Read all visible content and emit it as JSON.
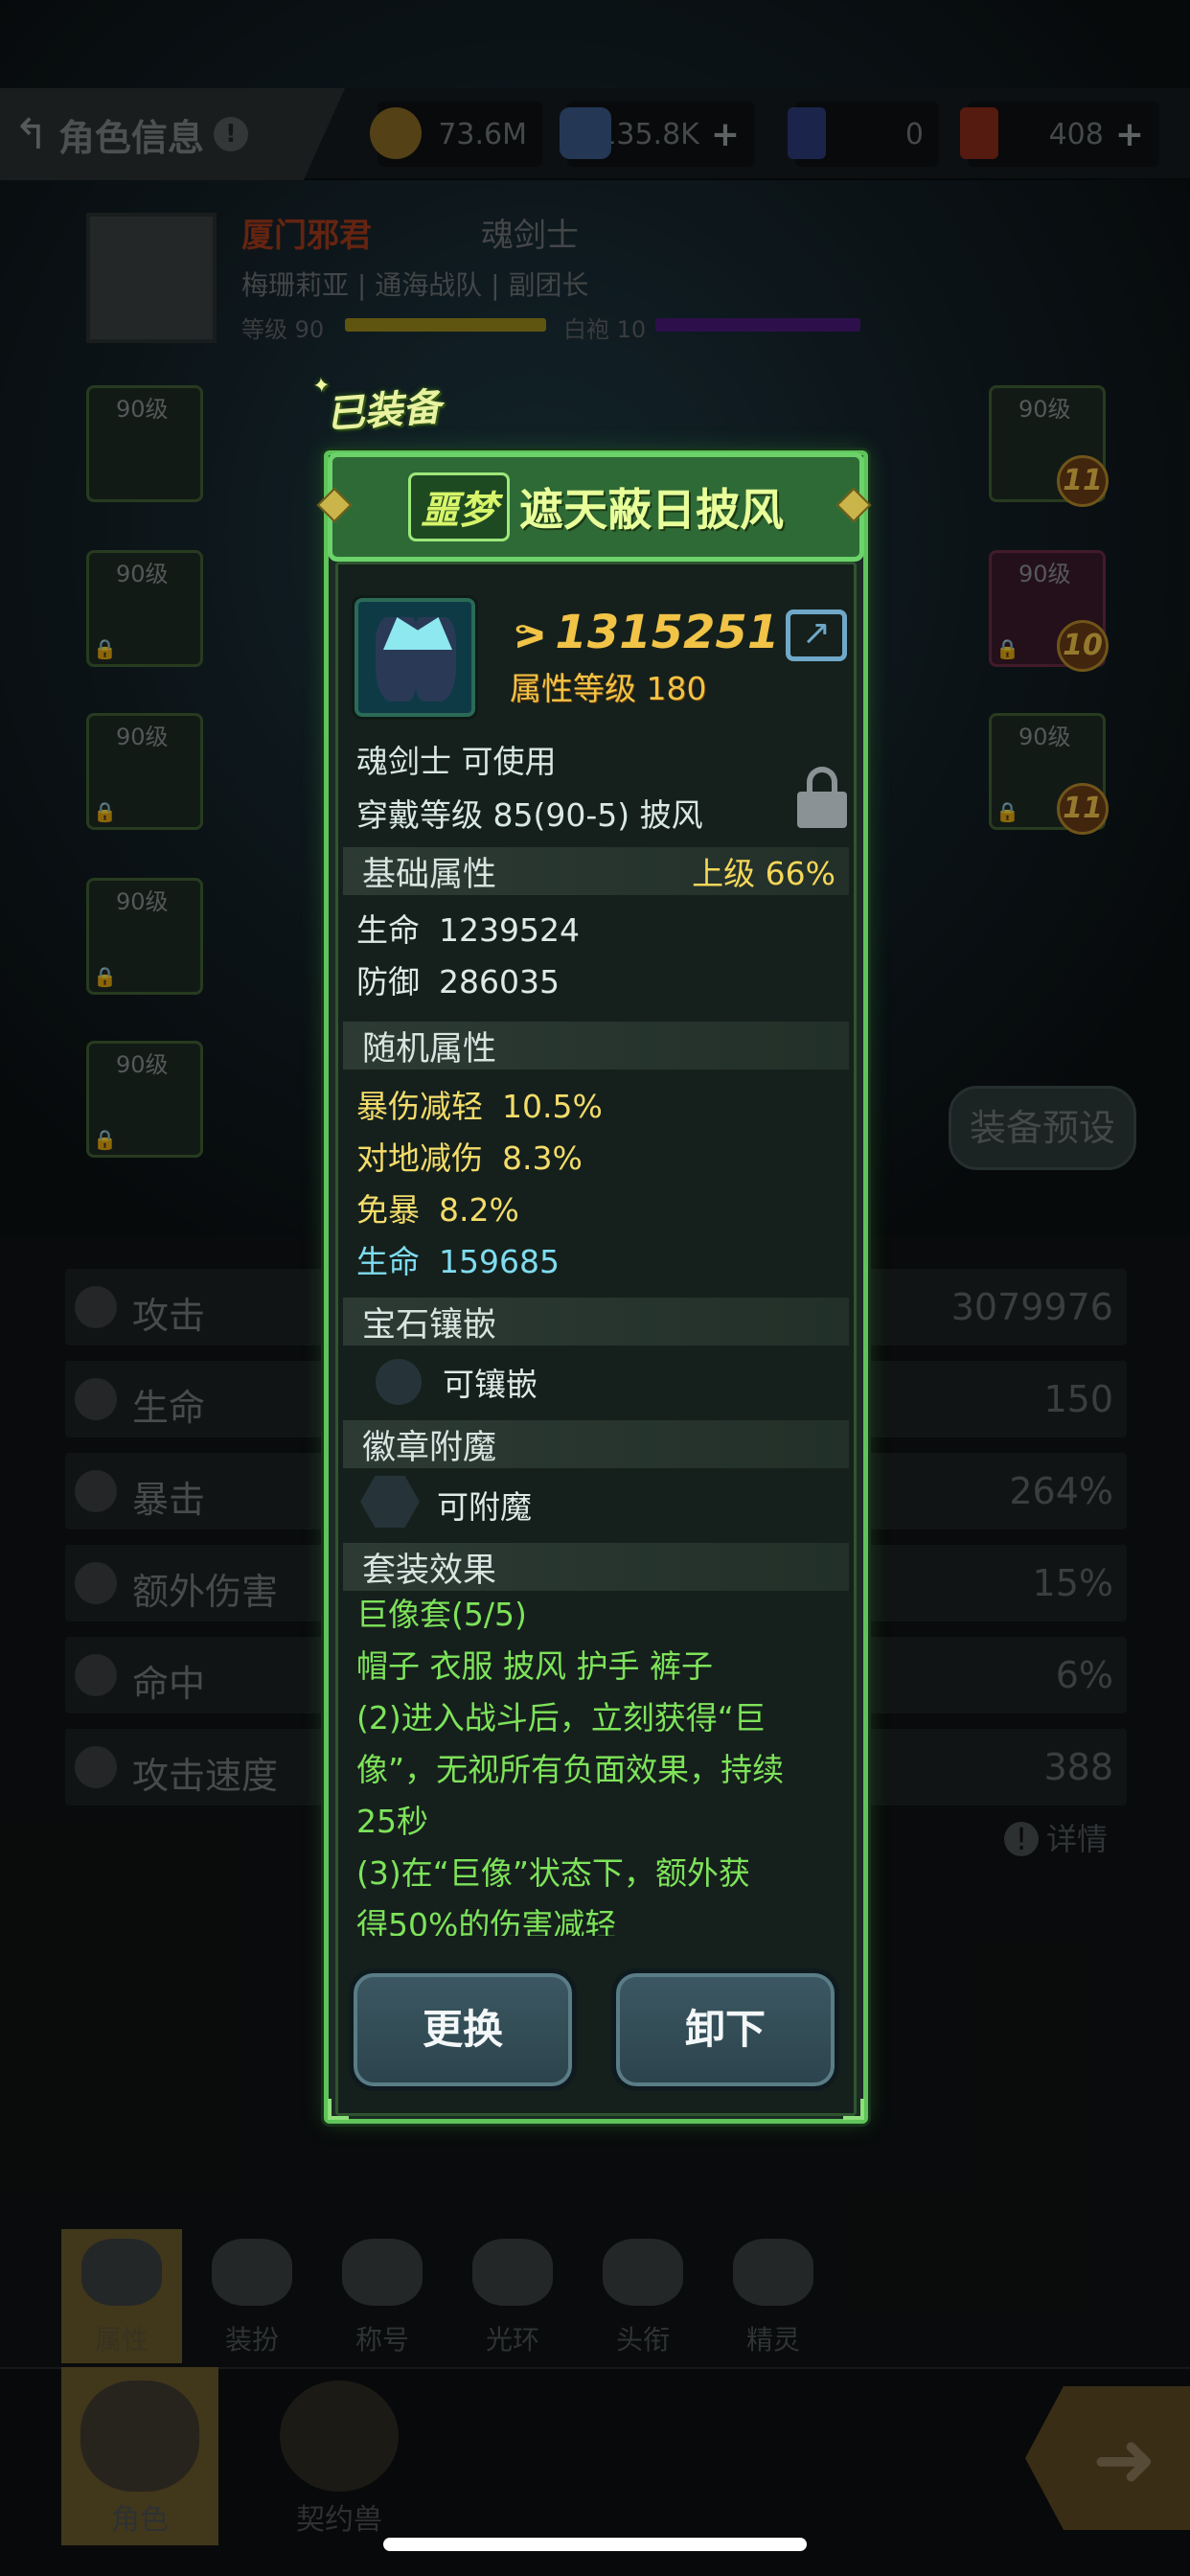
{
  "header": {
    "title": "角色信息",
    "help": "!",
    "resources": [
      {
        "icon": "gold-coin-icon",
        "value": "73.6M"
      },
      {
        "icon": "crystal-icon",
        "value": "135.8K",
        "plus": "+"
      },
      {
        "icon": "card-ticket-icon",
        "value": "0"
      },
      {
        "icon": "red-card-icon",
        "value": "408",
        "plus": "+"
      }
    ]
  },
  "profile": {
    "name": "厦门邪君",
    "class": "魂剑士",
    "guild_line": "梅珊莉亚 | 通海战队 | 副团长",
    "level_label": "等级 90",
    "robe_label": "白袍 10"
  },
  "slots_left": [
    {
      "level": "90级"
    },
    {
      "level": "90级"
    },
    {
      "level": "90级"
    },
    {
      "level": "90级"
    },
    {
      "level": "90级"
    }
  ],
  "slots_right": [
    {
      "level": "90级",
      "badge": "11"
    },
    {
      "level": "90级",
      "badge": "10"
    },
    {
      "level": "90级",
      "badge": "11"
    }
  ],
  "stats": [
    {
      "label": "攻击",
      "value": "3079976"
    },
    {
      "label": "生命",
      "value": "150"
    },
    {
      "label": "暴击",
      "value": "264%"
    },
    {
      "label": "额外伤害",
      "value": "15%"
    },
    {
      "label": "命中",
      "value": "6%"
    },
    {
      "label": "攻击速度",
      "value": "388"
    }
  ],
  "preset_label": "装备预设",
  "details_label": "详情",
  "bottom": {
    "sub_tabs": [
      "属性",
      "装扮",
      "称号",
      "光环",
      "头衔",
      "精灵"
    ],
    "main_tabs": [
      "角色",
      "契约兽"
    ]
  },
  "item": {
    "equipped_label": "已装备",
    "tag": "噩梦",
    "name": "遮天蔽日披风",
    "power": "1315251",
    "attr_level": "属性等级 180",
    "usable": "魂剑士 可使用",
    "wear": "穿戴等级 85(90-5) 披风",
    "base_section": "基础属性",
    "base_grade": "上级 66%",
    "base_attrs": [
      {
        "k": "生命",
        "v": "1239524"
      },
      {
        "k": "防御",
        "v": "286035"
      }
    ],
    "random_section": "随机属性",
    "random_attrs": [
      {
        "k": "暴伤减轻",
        "v": "10.5%"
      },
      {
        "k": "对地减伤",
        "v": "8.3%"
      },
      {
        "k": "免暴",
        "v": "8.2%"
      },
      {
        "k": "生命",
        "v": "159685"
      }
    ],
    "gem_section": "宝石镶嵌",
    "gem_text": "可镶嵌",
    "badge_section": "徽章附魔",
    "badge_text": "可附魔",
    "set_section": "套装效果",
    "set_lines": [
      "巨像套(5/5)",
      "帽子 衣服 披风 护手 裤子",
      "(2)进入战斗后，立刻获得“巨",
      "像”，无视所有负面效果，持续",
      "25秒",
      "(3)在“巨像”状态下，额外获",
      "得50%的伤害减轻"
    ],
    "btn_replace": "更换",
    "btn_unequip": "卸下"
  }
}
